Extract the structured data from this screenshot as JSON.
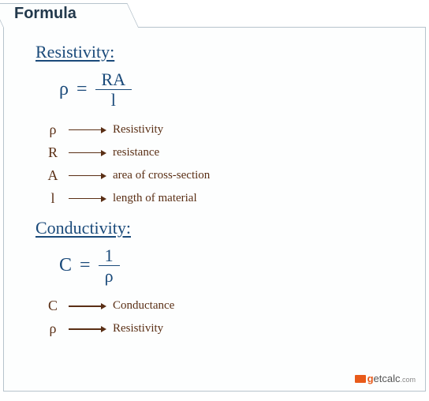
{
  "tab_title": "Formula",
  "sections": {
    "resistivity": {
      "title": "Resistivity:",
      "formula": {
        "lhs": "ρ",
        "eq": "=",
        "num": "RA",
        "den": "l"
      },
      "legend": [
        {
          "sym": "ρ",
          "desc": "Resistivity"
        },
        {
          "sym": "R",
          "desc": "resistance"
        },
        {
          "sym": "A",
          "desc": "area of cross-section"
        },
        {
          "sym": "l",
          "desc": "length of material"
        }
      ]
    },
    "conductivity": {
      "title": "Conductivity:",
      "formula": {
        "lhs": "C",
        "eq": "=",
        "num": "1",
        "den": "ρ"
      },
      "legend": [
        {
          "sym": "C",
          "desc": "Conductance"
        },
        {
          "sym": "ρ",
          "desc": "Resistivity"
        }
      ]
    }
  },
  "watermark": {
    "brand_g": "g",
    "brand_rest": "etcalc",
    "tld": ".com"
  }
}
